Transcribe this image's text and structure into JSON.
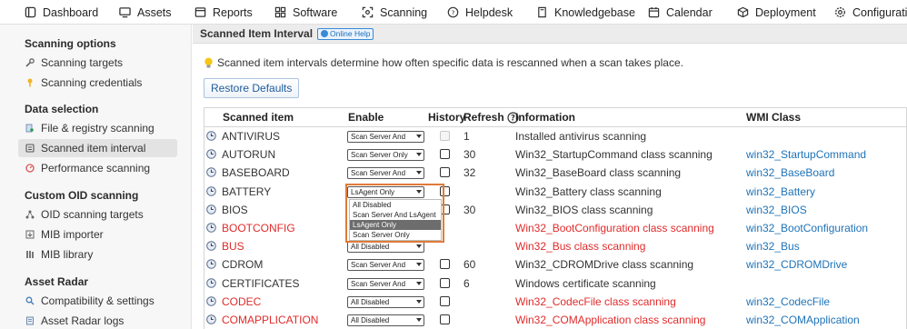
{
  "nav": [
    {
      "label": "Dashboard",
      "icon": "dashboard-icon"
    },
    {
      "label": "Assets",
      "icon": "monitor-icon"
    },
    {
      "label": "Reports",
      "icon": "reports-icon"
    },
    {
      "label": "Software",
      "icon": "software-icon"
    },
    {
      "label": "Scanning",
      "icon": "scan-icon"
    },
    {
      "label": "Helpdesk",
      "icon": "help-icon"
    },
    {
      "label": "Knowledgebase",
      "icon": "book-icon"
    },
    {
      "label": "Calendar",
      "icon": "calendar-icon"
    },
    {
      "label": "Deployment",
      "icon": "box-icon"
    },
    {
      "label": "Configuration",
      "icon": "gear-icon"
    }
  ],
  "sidebar": {
    "sections": [
      {
        "title": "Scanning options",
        "items": [
          "Scanning targets",
          "Scanning credentials"
        ]
      },
      {
        "title": "Data selection",
        "items": [
          "File & registry scanning",
          "Scanned item interval",
          "Performance scanning"
        ]
      },
      {
        "title": "Custom OID scanning",
        "items": [
          "OID scanning targets",
          "MIB importer",
          "MIB library"
        ]
      },
      {
        "title": "Asset Radar",
        "items": [
          "Compatibility & settings",
          "Asset Radar logs"
        ]
      }
    ],
    "active": "Scanned item interval"
  },
  "main": {
    "title": "Scanned Item Interval",
    "help_label": "Online Help",
    "info_text": "Scanned item intervals determine how often specific data is rescanned when a scan takes place.",
    "restore_label": "Restore Defaults",
    "columns": [
      "Scanned item",
      "Enable",
      "History",
      "Refresh",
      "Information",
      "WMI Class"
    ],
    "rows": [
      {
        "name": "ANTIVIRUS",
        "color": "dark",
        "enable": "Scan Server And",
        "history": "disabled",
        "refresh": "1",
        "info": "Installed antivirus scanning",
        "wmi": ""
      },
      {
        "name": "AUTORUN",
        "color": "dark",
        "enable": "Scan Server Only",
        "history": "enabled",
        "refresh": "30",
        "info": "Win32_StartupCommand class scanning",
        "wmi": "win32_StartupCommand"
      },
      {
        "name": "BASEBOARD",
        "color": "dark",
        "enable": "Scan Server And",
        "history": "enabled",
        "refresh": "32",
        "info": "Win32_BaseBoard class scanning",
        "wmi": "win32_BaseBoard"
      },
      {
        "name": "BATTERY",
        "color": "dark",
        "enable": "LsAgent Only",
        "history": "enabled",
        "refresh": "",
        "info": "Win32_Battery class scanning",
        "wmi": "win32_Battery"
      },
      {
        "name": "BIOS",
        "color": "dark",
        "enable": "",
        "history": "enabled",
        "refresh": "30",
        "info": "Win32_BIOS class scanning",
        "wmi": "win32_BIOS"
      },
      {
        "name": "BOOTCONFIG",
        "color": "red",
        "enable": "",
        "history": "",
        "refresh": "",
        "info": "Win32_BootConfiguration class scanning",
        "wmi": "win32_BootConfiguration"
      },
      {
        "name": "BUS",
        "color": "red",
        "enable": "All Disabled",
        "history": "",
        "refresh": "",
        "info": "Win32_Bus class scanning",
        "wmi": "win32_Bus"
      },
      {
        "name": "CDROM",
        "color": "dark",
        "enable": "Scan Server And",
        "history": "enabled",
        "refresh": "60",
        "info": "Win32_CDROMDrive class scanning",
        "wmi": "win32_CDROMDrive"
      },
      {
        "name": "CERTIFICATES",
        "color": "dark",
        "enable": "Scan Server And",
        "history": "enabled",
        "refresh": "6",
        "info": "Windows certificate scanning",
        "wmi": ""
      },
      {
        "name": "CODEC",
        "color": "red",
        "enable": "All Disabled",
        "history": "enabled",
        "refresh": "",
        "info": "Win32_CodecFile class scanning",
        "wmi": "win32_CodecFile"
      },
      {
        "name": "COMAPPLICATION",
        "color": "red",
        "enable": "All Disabled",
        "history": "enabled",
        "refresh": "",
        "info": "Win32_COMApplication class scanning",
        "wmi": "win32_COMApplication"
      }
    ],
    "dropdown_options": [
      "All Disabled",
      "Scan Server And LsAgent",
      "LsAgent Only",
      "Scan Server Only"
    ],
    "dropdown_selected": "LsAgent Only"
  },
  "colors": {
    "accent": "#1f73b7",
    "disabled_item": "#e02b2b",
    "highlight_frame": "#e07b39"
  }
}
